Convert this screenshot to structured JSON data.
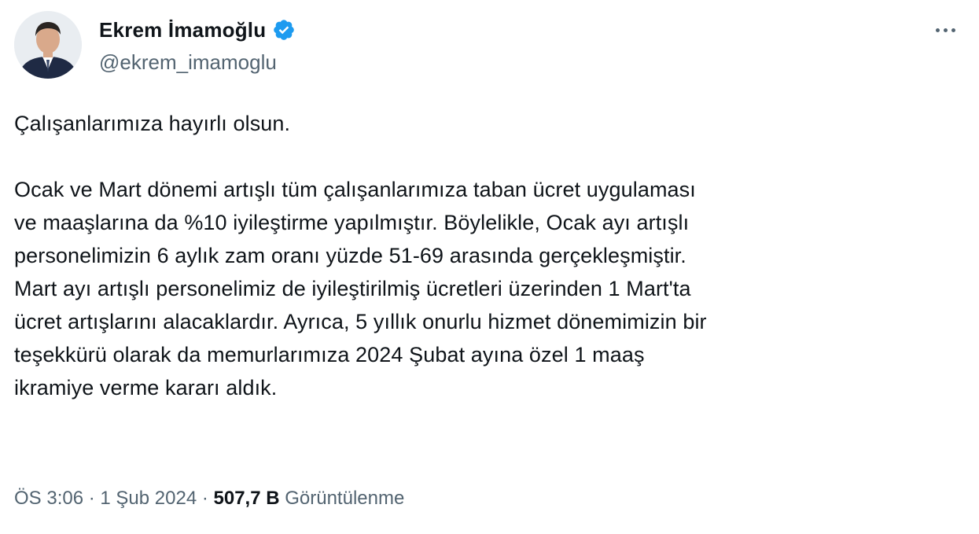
{
  "author": {
    "display_name": "Ekrem İmamoğlu",
    "handle": "@ekrem_imamoglu",
    "verified": true,
    "verified_color": "#1d9bf0"
  },
  "icons": {
    "verified": "verified-badge-icon",
    "more": "more-horizontal-icon"
  },
  "tweet": {
    "paragraph_1": "Çalışanlarımıza hayırlı olsun.",
    "paragraph_2_lines": [
      "Ocak ve Mart dönemi artışlı tüm çalışanlarımıza taban ücret uygulaması",
      "ve maaşlarına da %10 iyileştirme yapılmıştır. Böylelikle, Ocak ayı artışlı",
      "personelimizin 6 aylık zam oranı yüzde 51-69 arasında gerçekleşmiştir.",
      "Mart ayı artışlı personelimiz de iyileştirilmiş ücretleri üzerinden 1 Mart'ta",
      "ücret artışlarını alacaklardır. Ayrıca, 5 yıllık onurlu hizmet dönemimizin bir",
      "teşekkürü olarak da memurlarımıza 2024 Şubat ayına özel 1 maaş",
      "ikramiye verme kararı aldık."
    ]
  },
  "meta": {
    "time": "ÖS 3:06",
    "separator_1": " · ",
    "date": "1 Şub 2024",
    "separator_2": " · ",
    "views_count": "507,7 B",
    "views_label": " Görüntülenme"
  }
}
